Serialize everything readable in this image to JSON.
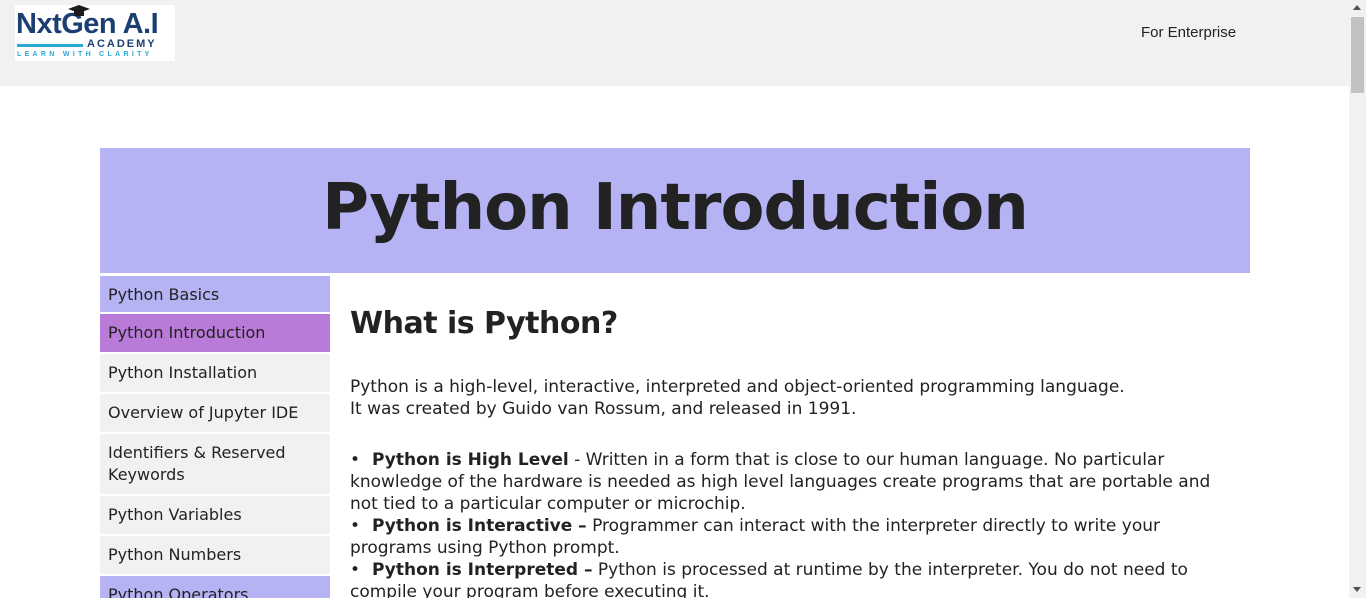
{
  "header": {
    "logo": {
      "line1": "NxtGen A.I",
      "line2": "ACADEMY",
      "line3": "LEARN WITH CLARITY"
    },
    "nav_link": "For Enterprise"
  },
  "banner": {
    "title": "Python Introduction"
  },
  "sidebar": {
    "items": [
      {
        "label": "Python Basics"
      },
      {
        "label": "Python Introduction"
      },
      {
        "label": "Python Installation"
      },
      {
        "label": "Overview of Jupyter IDE"
      },
      {
        "label": "Identifiers & Reserved Keywords"
      },
      {
        "label": "Python Variables"
      },
      {
        "label": "Python Numbers"
      },
      {
        "label": "Python Operators"
      }
    ]
  },
  "main": {
    "heading": "What is Python?",
    "intro_line1": "Python is a high-level, interactive, interpreted and object-oriented programming language.",
    "intro_line2": "It was created by Guido van Rossum, and released in 1991.",
    "bullets": [
      {
        "bullet": "•",
        "term": "Python is High Level",
        "text": " - Written in a form that is close to our human language. No particular knowledge of the hardware is needed as high level languages create programs that are portable and not tied to a particular computer or microchip."
      },
      {
        "bullet": "•",
        "term": "Python is Interactive –",
        "text": " Programmer can interact with the interpreter directly to write your programs using Python prompt."
      },
      {
        "bullet": "•",
        "term": "Python is Interpreted –",
        "text": " Python is processed at runtime by the interpreter. You do not need to compile your program before executing it."
      }
    ]
  },
  "colors": {
    "header_bg": "#f1f1f3",
    "banner_bg": "#b5b3f4",
    "active_item": "#b97ad8",
    "logo_navy": "#1c3f73",
    "logo_cyan": "#2aa8d8"
  }
}
